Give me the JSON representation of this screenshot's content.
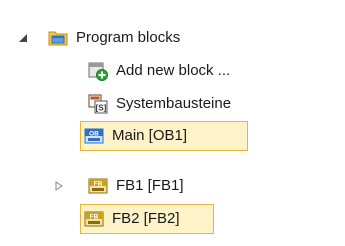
{
  "tree": {
    "root": {
      "label": "Program blocks",
      "icon": "folder-icon",
      "expanded": true
    },
    "items": [
      {
        "label": "Add new block ...",
        "icon": "add-block-icon",
        "selected": false,
        "has_children": false
      },
      {
        "label": "Systembausteine",
        "icon": "system-blocks-icon",
        "selected": false,
        "has_children": false
      },
      {
        "label": "Main [OB1]",
        "icon": "ob-block-icon",
        "icon_text": "OB",
        "selected": true,
        "has_children": false
      },
      {
        "label": "FB1 [FB1]",
        "icon": "fb-block-icon",
        "icon_text": "FB",
        "selected": false,
        "has_children": true
      },
      {
        "label": "FB2 [FB2]",
        "icon": "fb-block-icon",
        "icon_text": "FB",
        "selected": true,
        "has_children": false
      }
    ],
    "colors": {
      "selection_fill": "#fdf2c8",
      "selection_border": "#e8b53c",
      "folder_yellow": "#e7b531",
      "add_green": "#29a33a",
      "ob_blue": "#2f6fc4"
    }
  }
}
